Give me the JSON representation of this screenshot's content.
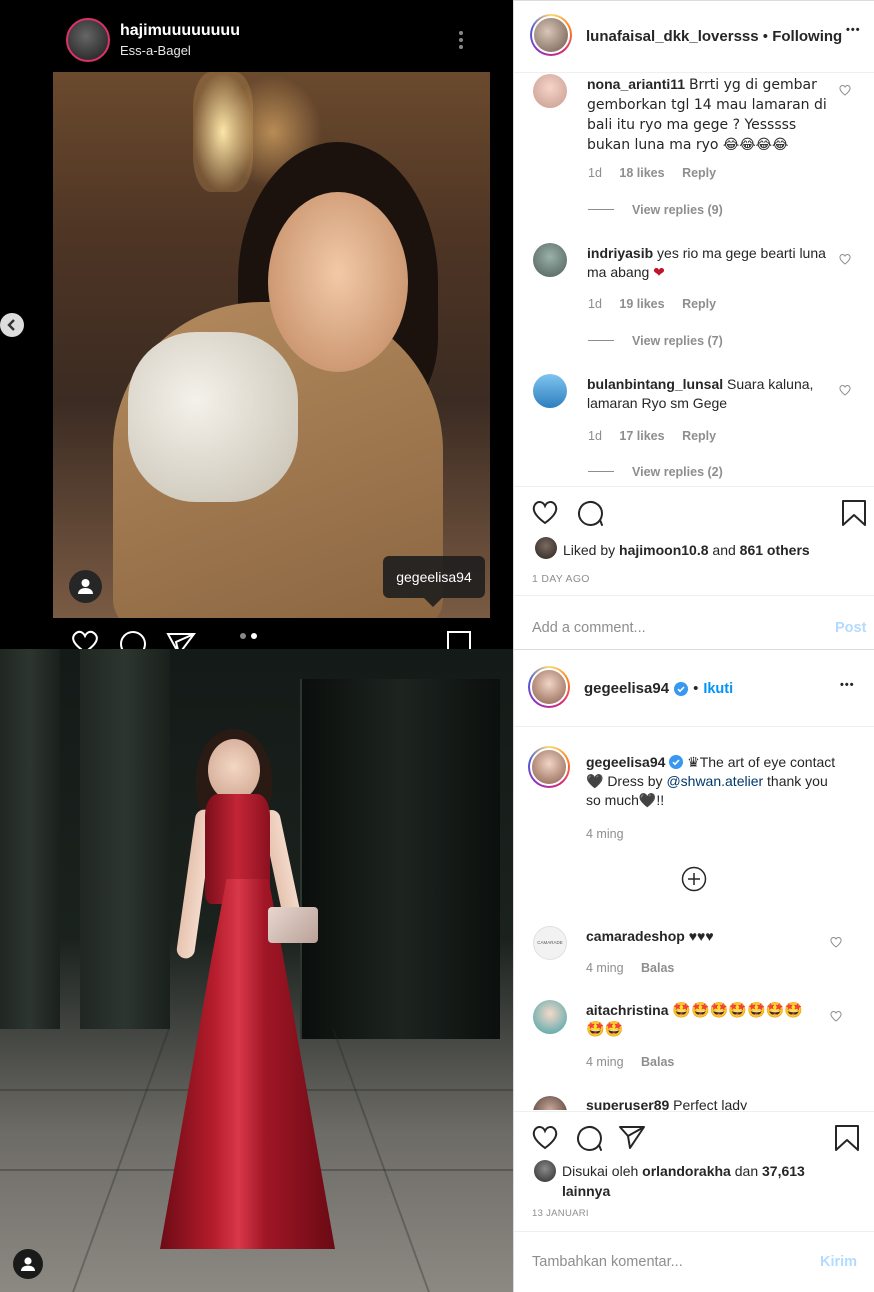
{
  "story": {
    "username": "hajimuuuuuuuu",
    "location": "Ess-a-Bagel",
    "tag": "gegeelisa94"
  },
  "post1": {
    "header": {
      "username": "lunafaisal_dkk_loversss",
      "separator": "•",
      "follow_status": "Following",
      "more": "•••"
    },
    "comments": [
      {
        "username": "nona_arianti11",
        "text": "Brrti yg di gembar gemborkan tgl 14 mau lamaran di bali itu ryo ma gege ? Yesssss bukan luna ma ryo 😂😂😂😂",
        "time": "1d",
        "likes": "18 likes",
        "reply": "Reply",
        "view_replies": "View replies (9)"
      },
      {
        "username": "indriyasib",
        "text": "yes rio ma gege bearti luna ma abang ❤",
        "time": "1d",
        "likes": "19 likes",
        "reply": "Reply",
        "view_replies": "View replies (7)"
      },
      {
        "username": "bulanbintang_lunsal",
        "text": "Suara kaluna, lamaran Ryo sm Gege",
        "time": "1d",
        "likes": "17 likes",
        "reply": "Reply",
        "view_replies": "View replies (2)"
      }
    ],
    "liked_by_prefix": "Liked by",
    "liked_by_user": "hajimoon10.8",
    "liked_by_and": "and",
    "liked_by_others": "861 others",
    "timestamp": "1 DAY AGO",
    "add_comment_placeholder": "Add a comment...",
    "post_button": "Post"
  },
  "post2": {
    "header": {
      "username": "gegeelisa94",
      "separator": "•",
      "follow_status": "Ikuti",
      "more": "•••"
    },
    "caption": {
      "username": "gegeelisa94",
      "text_before": "♛The art of eye contact🖤 Dress by",
      "mention": "@shwan.atelier",
      "text_after": "thank you so much🖤!!",
      "time": "4 ming"
    },
    "comments": [
      {
        "username": "camaradeshop",
        "text": "♥♥♥",
        "time": "4 ming",
        "reply": "Balas",
        "avatar_text": "CAMARADE"
      },
      {
        "username": "aitachristina",
        "text": "🤩🤩🤩🤩🤩🤩🤩🤩🤩",
        "time": "4 ming",
        "reply": "Balas"
      },
      {
        "username": "superuser89",
        "text": "Perfect lady"
      }
    ],
    "liked_by_prefix": "Disukai oleh",
    "liked_by_user": "orlandorakha",
    "liked_by_and": "dan",
    "liked_by_others": "37,613 lainnya",
    "timestamp": "13 JANUARI",
    "add_comment_placeholder": "Tambahkan komentar...",
    "post_button": "Kirim"
  },
  "icons": {
    "heart": "heart-icon",
    "comment": "comment-icon",
    "share": "share-icon",
    "save": "bookmark-icon",
    "add": "plus-circle-icon",
    "verified": "verified-badge-icon"
  },
  "colors": {
    "link": "#00376b",
    "follow_blue": "#0095f6",
    "verified_blue": "#3897f0",
    "heart_red": "#c0152a",
    "muted": "#8e8e8e"
  }
}
